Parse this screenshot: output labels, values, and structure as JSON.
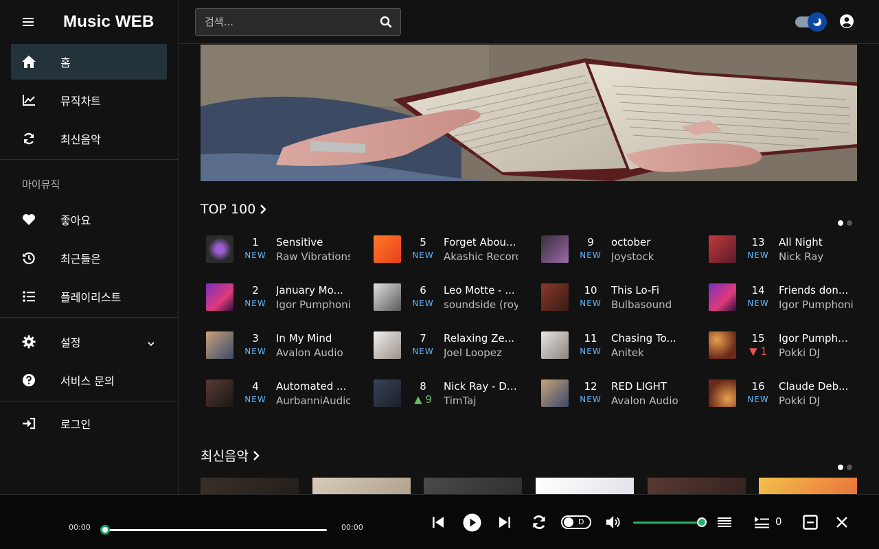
{
  "app": {
    "title": "Music WEB"
  },
  "sidebar": {
    "main_items": [
      {
        "label": "홈",
        "icon": "home-icon",
        "active": true
      },
      {
        "label": "뮤직차트",
        "icon": "chart-line-icon"
      },
      {
        "label": "최신음악",
        "icon": "refresh-icon"
      }
    ],
    "my_music_label": "마이뮤직",
    "my_items": [
      {
        "label": "좋아요",
        "icon": "heart-icon"
      },
      {
        "label": "최근들은",
        "icon": "history-icon"
      },
      {
        "label": "플레이리스트",
        "icon": "list-icon"
      }
    ],
    "settings_label": "설정",
    "support_label": "서비스 문의",
    "login_label": "로그인"
  },
  "search": {
    "placeholder": "검색..."
  },
  "top100": {
    "title": "TOP 100",
    "items": [
      {
        "rank": "1",
        "change": "NEW",
        "title": "Sensitive",
        "artist": "Raw Vibrations"
      },
      {
        "rank": "2",
        "change": "NEW",
        "title": "January Mo...",
        "artist": "Igor Pumphonia"
      },
      {
        "rank": "3",
        "change": "NEW",
        "title": "In My Mind",
        "artist": "Avalon Audio"
      },
      {
        "rank": "4",
        "change": "NEW",
        "title": "Automated ...",
        "artist": "AurbanniAudio"
      },
      {
        "rank": "5",
        "change": "NEW",
        "title": "Forget Abou...",
        "artist": "Akashic Records"
      },
      {
        "rank": "6",
        "change": "NEW",
        "title": "Leo Motte - ...",
        "artist": "soundside (roy"
      },
      {
        "rank": "7",
        "change": "NEW",
        "title": "Relaxing Ze...",
        "artist": "Joel Loopez"
      },
      {
        "rank": "8",
        "change": "▲ 9",
        "title": "Nick Ray - Di...",
        "artist": "TimTaj"
      },
      {
        "rank": "9",
        "change": "NEW",
        "title": "october",
        "artist": "Joystock"
      },
      {
        "rank": "10",
        "change": "NEW",
        "title": "This Lo-Fi",
        "artist": "Bulbasound"
      },
      {
        "rank": "11",
        "change": "NEW",
        "title": "Chasing To...",
        "artist": "Anitek"
      },
      {
        "rank": "12",
        "change": "NEW",
        "title": "RED LIGHT",
        "artist": "Avalon Audio"
      },
      {
        "rank": "13",
        "change": "NEW",
        "title": "All Night",
        "artist": "Nick Ray"
      },
      {
        "rank": "14",
        "change": "NEW",
        "title": "Friends don...",
        "artist": "Igor Pumphonia"
      },
      {
        "rank": "15",
        "change": "▼ 1",
        "title": "Igor Pumpho...",
        "artist": "Pokki DJ"
      },
      {
        "rank": "16",
        "change": "NEW",
        "title": "Claude Deb...",
        "artist": "Pokki DJ"
      }
    ]
  },
  "latest": {
    "title": "최신음악"
  },
  "player": {
    "time_current": "00:00",
    "time_total": "00:00",
    "repeat_mode": "D",
    "queue_count": "0",
    "progress": 0,
    "volume": 1.0
  },
  "colors": {
    "accent_green": "#28b36b",
    "rank_new": "#64b5f6",
    "rank_up": "#66bb6a",
    "rank_down": "#ef5350",
    "active_nav": "#24333a"
  }
}
